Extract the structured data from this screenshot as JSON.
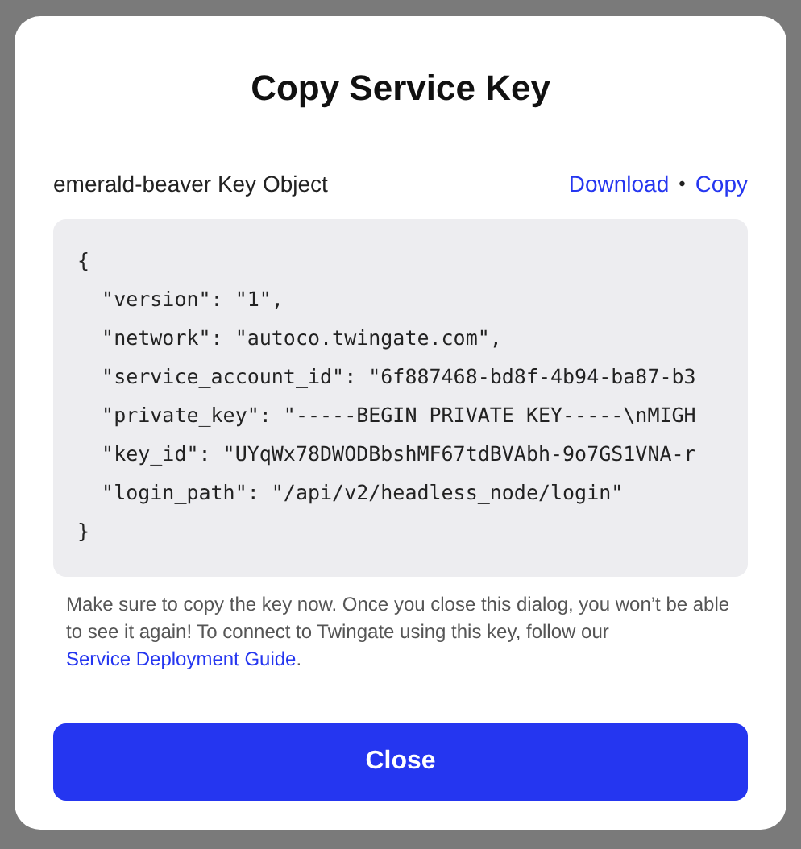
{
  "dialog": {
    "title": "Copy Service Key",
    "key_label": "emerald-beaver Key Object",
    "actions": [
      {
        "label": "Download"
      },
      {
        "label": "Copy"
      }
    ],
    "separator": "•",
    "code_lines": [
      "{",
      "  \"version\": \"1\",",
      "  \"network\": \"autoco.twingate.com\",",
      "  \"service_account_id\": \"6f887468-bd8f-4b94-ba87-b3",
      "  \"private_key\": \"-----BEGIN PRIVATE KEY-----\\nMIGH",
      "  \"key_id\": \"UYqWx78DWODBbshMF67tdBVAbh-9o7GS1VNA-r",
      "  \"login_path\": \"/api/v2/headless_node/login\"",
      "}"
    ],
    "note": {
      "text": "Make sure to copy the key now. Once you close this dialog, you won’t be able to see it again! To connect to Twingate using this key, follow our",
      "link": "Service Deployment Guide",
      "end": "."
    },
    "close_button": "Close"
  }
}
